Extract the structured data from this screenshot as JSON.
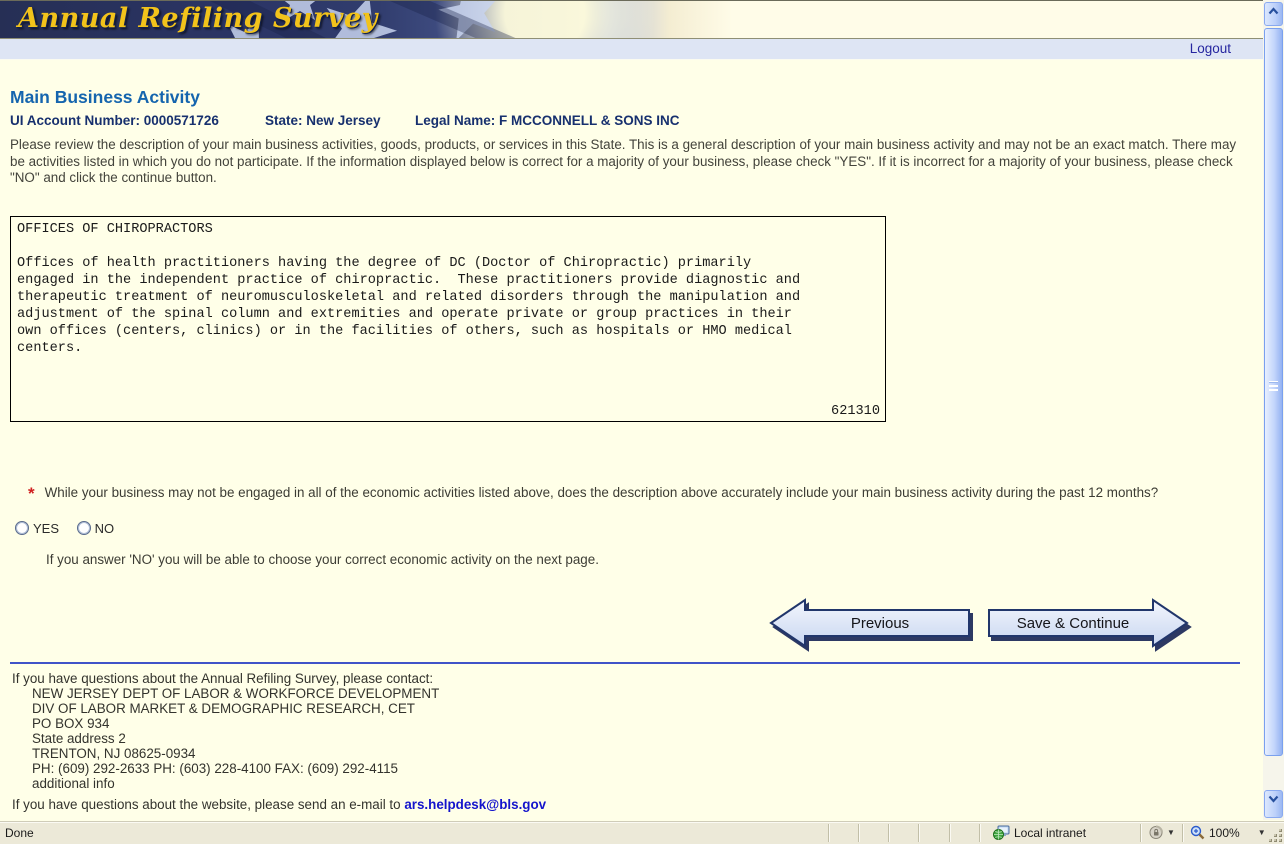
{
  "banner": {
    "title": "Annual Refiling Survey"
  },
  "nav": {
    "logout_label": "Logout"
  },
  "page": {
    "heading": "Main Business Activity",
    "account": {
      "ui_account": "UI Account Number: 0000571726",
      "state": "State: New Jersey",
      "legal_name": "Legal Name: F MCCONNELL & SONS INC"
    },
    "instructions": "Please review the description of your main business activities, goods, products, or services in this State. This is a general description of your main business activity and may not be an exact match. There may be activities listed in which you do not participate. If the information displayed below is correct for a majority of your business, please check \"YES\". If it is incorrect for a majority of your business, please check \"NO\" and click the continue button.",
    "description_box": {
      "text": "OFFICES OF CHIROPRACTORS\n\nOffices of health practitioners having the degree of DC (Doctor of Chiropractic) primarily\nengaged in the independent practice of chiropractic.  These practitioners provide diagnostic and\ntherapeutic treatment of neuromusculoskeletal and related disorders through the manipulation and\nadjustment of the spinal column and extremities and operate private or group practices in their\nown offices (centers, clinics) or in the facilities of others, such as hospitals or HMO medical\ncenters.",
      "naics_code": "621310"
    },
    "question": {
      "required_marker": "*",
      "text": "While your business may not be engaged in all of the economic activities listed above, does the description above accurately include your main business activity during the past 12 months?"
    },
    "options": [
      {
        "label": "YES"
      },
      {
        "label": "NO"
      }
    ],
    "note": "If you answer 'NO' you will be able to choose your correct economic activity on the next page.",
    "buttons": {
      "previous": "Previous",
      "save_continue": "Save & Continue"
    },
    "contact": {
      "intro": "If you have questions about the Annual Refiling Survey, please contact:",
      "lines": [
        "NEW JERSEY DEPT OF LABOR & WORKFORCE DEVELOPMENT",
        "DIV OF LABOR MARKET & DEMOGRAPHIC RESEARCH, CET",
        "PO BOX 934",
        "State address 2",
        "TRENTON, NJ 08625-0934",
        "PH: (609) 292-2633  PH: (603) 228-4100  FAX: (609) 292-4115",
        "additional info"
      ],
      "website_prefix": "If you have questions about the website, please send an e-mail to ",
      "email": "ars.helpdesk@bls.gov"
    }
  },
  "statusbar": {
    "status": "Done",
    "zone_label": "Local intranet",
    "zoom_level": "100%"
  },
  "icons": {
    "scroll_up": "chevron-up",
    "scroll_down": "chevron-down",
    "local_intranet": "monitor-globe",
    "security": "shield-dropdown",
    "zoom": "magnifier-plus",
    "dropdown_caret": "▼"
  },
  "colors": {
    "banner_navy": "#2B3566",
    "banner_gold": "#F2C31B",
    "page_cream": "#FFFFE8",
    "logout_bar": "#DEE5F4",
    "heading_blue": "#1565AE",
    "account_navy": "#17306E",
    "required_red": "#D02020",
    "rule_blue": "#4053C8",
    "email_blue": "#1414CC",
    "statusbar_beige": "#ECE9D8"
  }
}
